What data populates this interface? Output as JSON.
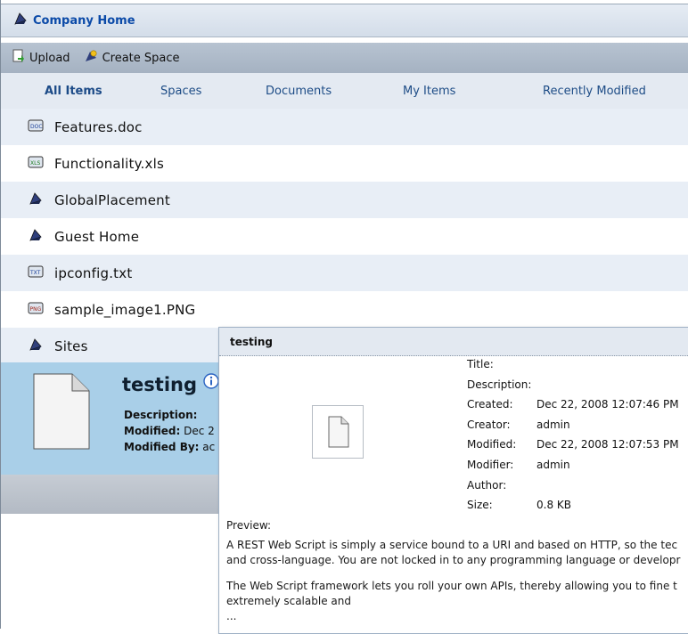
{
  "header": {
    "title": "Company Home"
  },
  "toolbar": {
    "upload_label": "Upload",
    "create_space_label": "Create Space"
  },
  "filters": [
    "All Items",
    "Spaces",
    "Documents",
    "My Items",
    "Recently Modified"
  ],
  "items": [
    {
      "name": "Features.doc",
      "icon": "word-doc-icon"
    },
    {
      "name": "Functionality.xls",
      "icon": "excel-xls-icon"
    },
    {
      "name": "GlobalPlacement",
      "icon": "space-folder-icon"
    },
    {
      "name": "Guest Home",
      "icon": "space-folder-icon"
    },
    {
      "name": "ipconfig.txt",
      "icon": "text-file-icon"
    },
    {
      "name": "sample_image1.PNG",
      "icon": "image-file-icon"
    },
    {
      "name": "Sites",
      "icon": "space-folder-icon"
    }
  ],
  "selected": {
    "title": "testing",
    "description_label": "Description:",
    "modified_label": "Modified:",
    "modified_value": "Dec 2",
    "modified_by_label": "Modified By:",
    "modified_by_value": "ac"
  },
  "popup": {
    "title": "testing",
    "properties": [
      {
        "k": "Title:",
        "v": ""
      },
      {
        "k": "Description:",
        "v": ""
      },
      {
        "k": "Created:",
        "v": "Dec 22, 2008 12:07:46 PM"
      },
      {
        "k": "Creator:",
        "v": "admin"
      },
      {
        "k": "Modified:",
        "v": "Dec 22, 2008 12:07:53 PM"
      },
      {
        "k": "Modifier:",
        "v": "admin"
      },
      {
        "k": "Author:",
        "v": ""
      },
      {
        "k": "Size:",
        "v": "0.8 KB"
      }
    ],
    "preview_label": "Preview:",
    "preview_lines": [
      "A REST Web Script is simply a service bound to a URI and based on HTTP, so the tec",
      "and cross-language. You are not locked in to any programming language or developr",
      "The Web Script framework lets you roll your own APIs, thereby allowing you to fine t",
      "extremely scalable and",
      "..."
    ]
  },
  "colors": {
    "accent": "#0b4aa8",
    "selected_row": "#a9cfe8",
    "alt_row": "#e8eef6"
  }
}
